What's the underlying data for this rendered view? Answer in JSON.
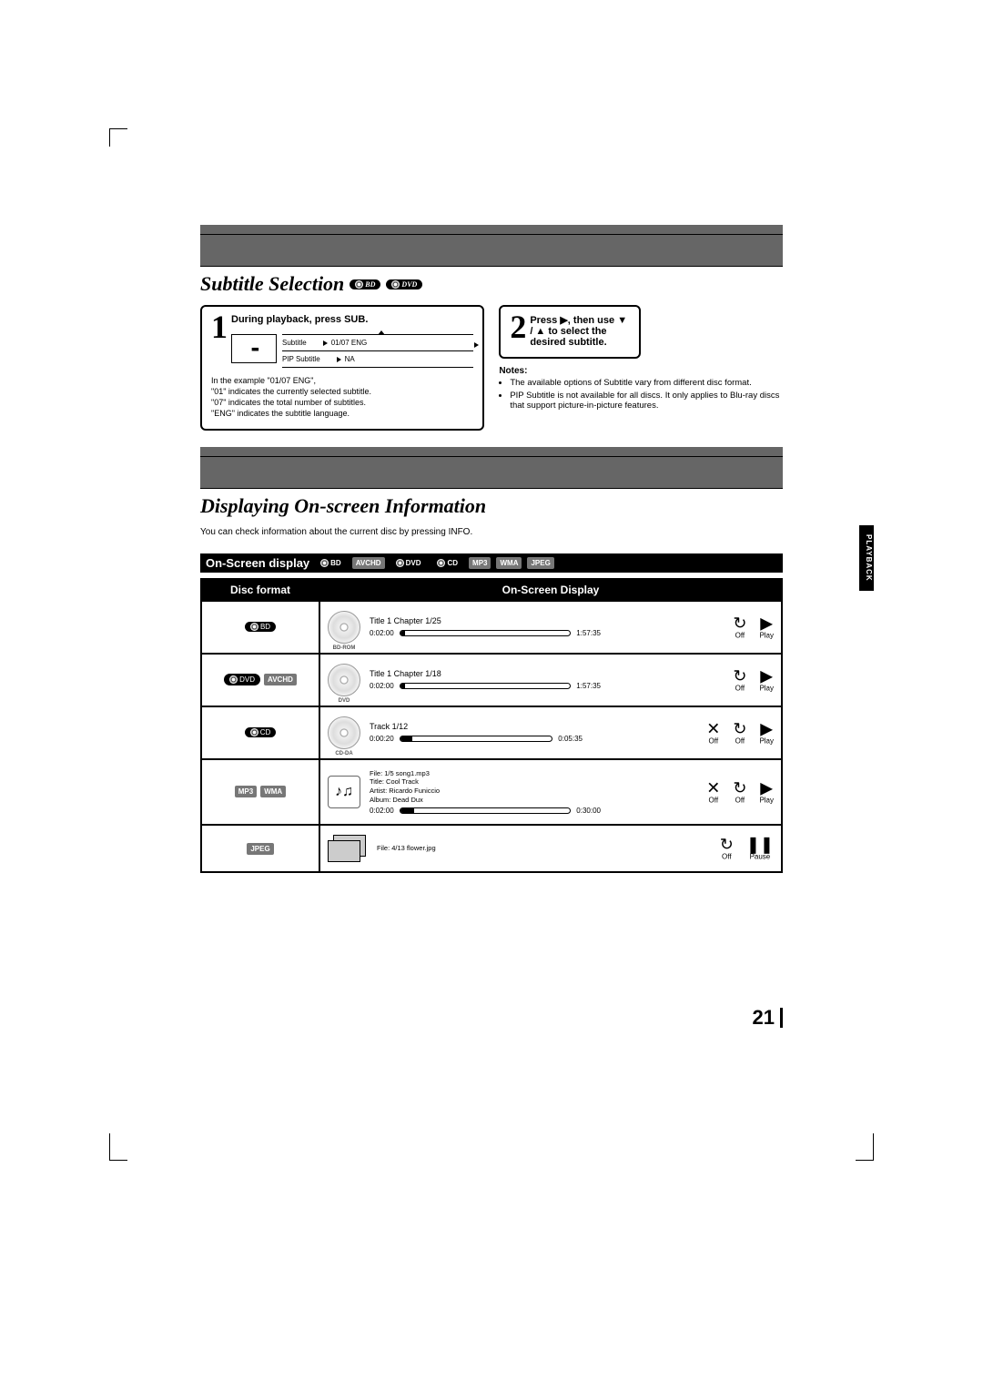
{
  "side_tab": "PLAYBACK",
  "page_number": "21",
  "section1": {
    "title": "Subtitle Selection",
    "step1_head": "During playback, press SUB.",
    "osd": {
      "row1_label": "Subtitle",
      "row1_value": "01/07 ENG",
      "row2_label": "PIP Subtitle",
      "row2_value": "NA"
    },
    "explain": [
      "In the example \"01/07 ENG\",",
      "\"01\" indicates the currently selected subtitle.",
      "\"07\" indicates the total number of subtitles.",
      "\"ENG\" indicates the subtitle language."
    ],
    "step2_head": "Press ▶, then use ▼ / ▲ to select the desired subtitle.",
    "notes_head": "Notes:",
    "notes": [
      "The available options of Subtitle vary from different disc format.",
      "PIP Subtitle is not available for all discs. It only applies to Blu-ray discs that support picture-in-picture features."
    ]
  },
  "section2": {
    "title": "Displaying On-screen Information",
    "desc": "You can check information about the current disc by pressing INFO.",
    "subhead": "On-Screen display",
    "th1": "Disc format",
    "th2": "On-Screen Display"
  },
  "formats": {
    "bd": "BD",
    "dvd": "DVD",
    "avchd": "AVCHD",
    "cd": "CD",
    "mp3": "MP3",
    "wma": "WMA",
    "jpeg": "JPEG"
  },
  "rows": {
    "bd": {
      "disc_label": "BD-ROM",
      "title": "Title 1 Chapter 1/25",
      "t_elapsed": "0:02:00",
      "t_total": "1:57:35",
      "fill_pct": 3,
      "icons": [
        {
          "sym": "↻",
          "label": "Off"
        },
        {
          "sym": "▶",
          "label": "Play"
        }
      ]
    },
    "dvd": {
      "disc_label": "DVD",
      "title": "Title 1 Chapter 1/18",
      "t_elapsed": "0:02:00",
      "t_total": "1:57:35",
      "fill_pct": 3,
      "icons": [
        {
          "sym": "↻",
          "label": "Off"
        },
        {
          "sym": "▶",
          "label": "Play"
        }
      ]
    },
    "cd": {
      "disc_label": "CD-DA",
      "title": "Track 1/12",
      "t_elapsed": "0:00:20",
      "t_total": "0:05:35",
      "fill_pct": 8,
      "icons": [
        {
          "sym": "✕",
          "label": "Off"
        },
        {
          "sym": "↻",
          "label": "Off"
        },
        {
          "sym": "▶",
          "label": "Play"
        }
      ]
    },
    "mp3": {
      "lines": [
        "File: 1/5  song1.mp3",
        "Title: Cool Track",
        "Artist: Ricardo Funiccio",
        "Album: Dead Dux"
      ],
      "t_elapsed": "0:02:00",
      "t_total": "0:30:00",
      "fill_pct": 8,
      "icons": [
        {
          "sym": "✕",
          "label": "Off"
        },
        {
          "sym": "↻",
          "label": "Off"
        },
        {
          "sym": "▶",
          "label": "Play"
        }
      ]
    },
    "jpeg": {
      "line": "File: 4/13 flower.jpg",
      "icons": [
        {
          "sym": "↻",
          "label": "Off"
        },
        {
          "sym": "❚❚",
          "label": "Pause"
        }
      ]
    }
  }
}
